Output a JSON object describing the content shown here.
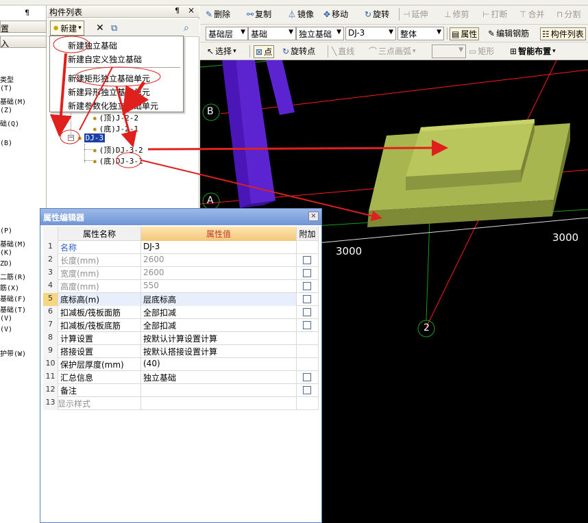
{
  "left_panel": {
    "header1": "置",
    "header2": "入",
    "pin": "¶",
    "items": [
      "类型",
      "(T)",
      "基础(M)",
      "(Z)",
      "础(Q)",
      "(B)",
      "(P)",
      "基础(M)",
      "(K)",
      "ZD)",
      "二筋(R)",
      "筋(X)",
      "基础(F)",
      "基础(T)",
      "(V)",
      "(V)",
      "护带(W)"
    ]
  },
  "component_list": {
    "title": "构件列表",
    "pin": "¶",
    "close": "×",
    "toolbar": {
      "new_label": "新建",
      "new_arrow": "▾",
      "delete_icon": "✕",
      "copy_icon": "⧉"
    },
    "tree": [
      {
        "label": "(顶)DJ-2-2",
        "visible": "(顶)J-2-2"
      },
      {
        "label": "(底)DJ-2-1",
        "visible": "(底)J-2-1"
      },
      {
        "label": "DJ-3"
      },
      {
        "label": "(顶)DJ-3-2"
      },
      {
        "label": "(底)DJ-3-1"
      }
    ],
    "expander_symbol": "−"
  },
  "dropdown_menu": {
    "items": [
      "新建独立基础",
      "新建自定义独立基础",
      "新建矩形独立基础单元",
      "新建异形独立基础单元",
      "新建参数化独立基础单元"
    ]
  },
  "toolbar1": {
    "items": [
      {
        "icon": "✎",
        "label": "删除",
        "disabled": false
      },
      {
        "icon": "⚯",
        "label": "复制",
        "disabled": false
      },
      {
        "icon": "⏃",
        "label": "镜像",
        "disabled": false
      },
      {
        "icon": "✥",
        "label": "移动",
        "disabled": false
      },
      {
        "icon": "↻",
        "label": "旋转",
        "disabled": false
      },
      {
        "icon": "⊣",
        "label": "延伸",
        "disabled": true
      },
      {
        "icon": "⊥",
        "label": "修剪",
        "disabled": true
      },
      {
        "icon": "⊢",
        "label": "打断",
        "disabled": true
      },
      {
        "icon": "⊤",
        "label": "合并",
        "disabled": true
      },
      {
        "icon": "⊓",
        "label": "分割",
        "disabled": true
      }
    ]
  },
  "toolbar2": {
    "combos": [
      "基础层",
      "基础",
      "独立基础",
      "DJ-3",
      "整体"
    ],
    "buttons": [
      {
        "icon": "▤",
        "label": "属性"
      },
      {
        "icon": "✎",
        "label": "编辑钢筋"
      },
      {
        "icon": "☷",
        "label": "构件列表"
      }
    ]
  },
  "toolbar3": {
    "select": {
      "icon": "↖",
      "label": "选择",
      "arrow": "▾"
    },
    "point": {
      "icon": "⊠",
      "label": "点"
    },
    "rotate_point": {
      "icon": "↻",
      "label": "旋转点"
    },
    "line": {
      "icon": "╲",
      "label": "直线"
    },
    "arc": {
      "icon": "⌒",
      "label": "三点画弧",
      "arrow": "▾"
    },
    "rect": {
      "icon": "▭",
      "label": "矩形"
    },
    "smart": {
      "icon": "⊞",
      "label": "智能布置",
      "arrow": "▾"
    }
  },
  "view3d": {
    "axis_labels": [
      "B",
      "A",
      "2"
    ],
    "dimensions": [
      "3000",
      "3000"
    ],
    "colors": {
      "foundation": "#9aa84a",
      "column": "#4b16b8",
      "gridline": "#ff1a1a",
      "gridline2": "#2fbf2f"
    }
  },
  "property_editor": {
    "title": "属性编辑器",
    "close": "×",
    "headers": {
      "name": "属性名称",
      "value": "属性值",
      "add": "附加"
    },
    "rows": [
      {
        "n": "1",
        "name": "名称",
        "value": "DJ-3",
        "check": false,
        "style": "blue"
      },
      {
        "n": "2",
        "name": "长度(mm)",
        "value": "2600",
        "check": true,
        "style": "grey"
      },
      {
        "n": "3",
        "name": "宽度(mm)",
        "value": "2600",
        "check": true,
        "style": "grey"
      },
      {
        "n": "4",
        "name": "高度(mm)",
        "value": "550",
        "check": true,
        "style": "grey"
      },
      {
        "n": "5",
        "name": "底标高(m)",
        "value": "层底标高",
        "check": true,
        "style": "selected"
      },
      {
        "n": "6",
        "name": "扣减板/筏板面筋",
        "value": "全部扣减",
        "check": true,
        "style": "normal"
      },
      {
        "n": "7",
        "name": "扣减板/筏板底筋",
        "value": "全部扣减",
        "check": true,
        "style": "normal"
      },
      {
        "n": "8",
        "name": "计算设置",
        "value": "按默认计算设置计算",
        "check": false,
        "style": "normal"
      },
      {
        "n": "9",
        "name": "搭接设置",
        "value": "按默认搭接设置计算",
        "check": false,
        "style": "normal"
      },
      {
        "n": "10",
        "name": "保护层厚度(mm)",
        "value": "(40)",
        "check": false,
        "style": "normal"
      },
      {
        "n": "11",
        "name": "汇总信息",
        "value": "独立基础",
        "check": true,
        "style": "normal"
      },
      {
        "n": "12",
        "name": "备注",
        "value": "",
        "check": true,
        "style": "normal"
      },
      {
        "n": "13",
        "name": "显示样式",
        "value": "",
        "check": false,
        "style": "expand"
      }
    ],
    "expand_symbol": "+"
  },
  "annotations": {
    "color": "#e0201c"
  }
}
